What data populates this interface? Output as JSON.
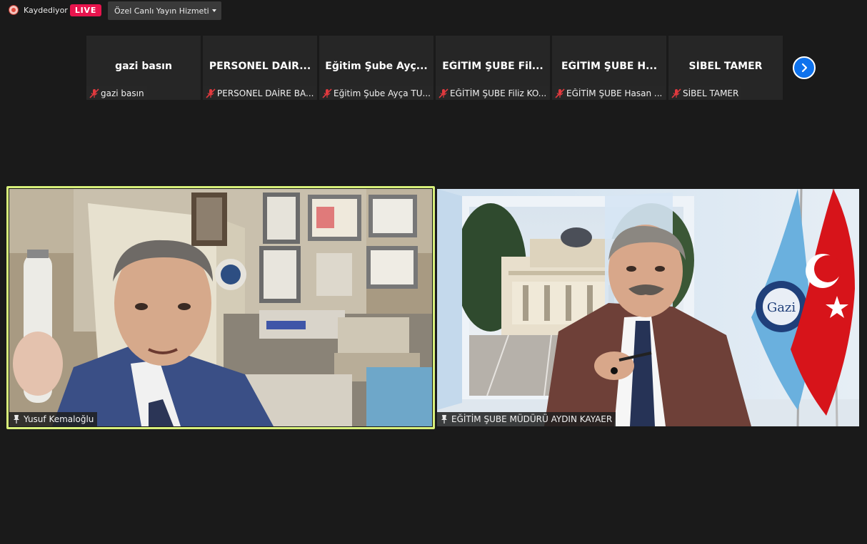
{
  "status": {
    "recording_label": "Kaydediyor",
    "live_badge": "LIVE",
    "stream_service": "Özel Canlı Yayın Hizmeti"
  },
  "filmstrip": [
    {
      "display_name": "gazi basın",
      "tag": "gazi basın"
    },
    {
      "display_name": "PERSONEL DAİR...",
      "tag": "PERSONEL DAİRE BA..."
    },
    {
      "display_name": "Eğitim Şube Ayç...",
      "tag": "Eğitim Şube Ayça TU..."
    },
    {
      "display_name": "EĞİTİM ŞUBE Fil...",
      "tag": "EĞİTİM ŞUBE Filiz KO..."
    },
    {
      "display_name": "EĞİTİM ŞUBE H...",
      "tag": "EĞİTİM ŞUBE Hasan ..."
    },
    {
      "display_name": "SİBEL TAMER",
      "tag": "SİBEL TAMER"
    }
  ],
  "videos": {
    "left_name": "Yusuf Kemaloğlu",
    "right_name": "EĞİTİM ŞUBE MÜDÜRÜ AYDIN KAYAER"
  },
  "colors": {
    "live": "#e8144d",
    "active_speaker": "#d8f07a",
    "next_button": "#0e72ed",
    "muted_mic": "#e0393e",
    "turkish_flag": "#d7141a",
    "university_flag": "#6ab0de"
  },
  "icons": {
    "recording": "record-dot-icon",
    "muted": "mic-muted-icon",
    "pin": "pin-icon",
    "next": "chevron-right-icon"
  }
}
